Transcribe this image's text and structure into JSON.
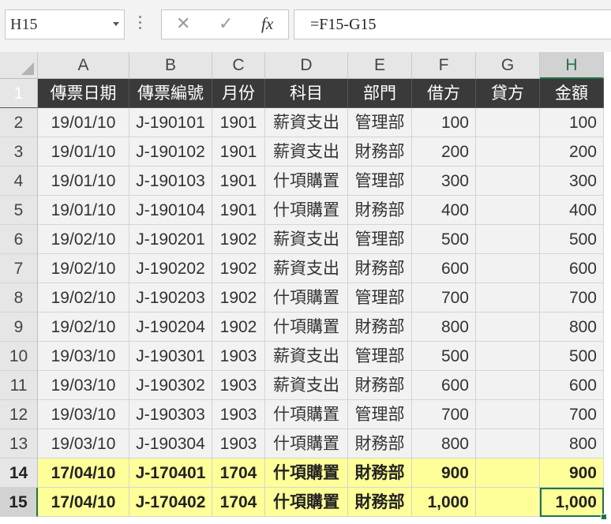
{
  "name_box": "H15",
  "formula": "=F15-G15",
  "fx_label": "fx",
  "columns": [
    "A",
    "B",
    "C",
    "D",
    "E",
    "F",
    "G",
    "H"
  ],
  "header_row": {
    "num": "1",
    "cells": [
      "傳票日期",
      "傳票編號",
      "月份",
      "科目",
      "部門",
      "借方",
      "貸方",
      "金額"
    ]
  },
  "rows": [
    {
      "num": "2",
      "cells": [
        "19/01/10",
        "J-190101",
        "1901",
        "薪資支出",
        "管理部",
        "100",
        "",
        "100"
      ]
    },
    {
      "num": "3",
      "cells": [
        "19/01/10",
        "J-190102",
        "1901",
        "薪資支出",
        "財務部",
        "200",
        "",
        "200"
      ]
    },
    {
      "num": "4",
      "cells": [
        "19/01/10",
        "J-190103",
        "1901",
        "什項購置",
        "管理部",
        "300",
        "",
        "300"
      ]
    },
    {
      "num": "5",
      "cells": [
        "19/01/10",
        "J-190104",
        "1901",
        "什項購置",
        "財務部",
        "400",
        "",
        "400"
      ]
    },
    {
      "num": "6",
      "cells": [
        "19/02/10",
        "J-190201",
        "1902",
        "薪資支出",
        "管理部",
        "500",
        "",
        "500"
      ]
    },
    {
      "num": "7",
      "cells": [
        "19/02/10",
        "J-190202",
        "1902",
        "薪資支出",
        "財務部",
        "600",
        "",
        "600"
      ]
    },
    {
      "num": "8",
      "cells": [
        "19/02/10",
        "J-190203",
        "1902",
        "什項購置",
        "管理部",
        "700",
        "",
        "700"
      ]
    },
    {
      "num": "9",
      "cells": [
        "19/02/10",
        "J-190204",
        "1902",
        "什項購置",
        "財務部",
        "800",
        "",
        "800"
      ]
    },
    {
      "num": "10",
      "cells": [
        "19/03/10",
        "J-190301",
        "1903",
        "薪資支出",
        "管理部",
        "500",
        "",
        "500"
      ]
    },
    {
      "num": "11",
      "cells": [
        "19/03/10",
        "J-190302",
        "1903",
        "薪資支出",
        "財務部",
        "600",
        "",
        "600"
      ]
    },
    {
      "num": "12",
      "cells": [
        "19/03/10",
        "J-190303",
        "1903",
        "什項購置",
        "管理部",
        "700",
        "",
        "700"
      ]
    },
    {
      "num": "13",
      "cells": [
        "19/03/10",
        "J-190304",
        "1903",
        "什項購置",
        "財務部",
        "800",
        "",
        "800"
      ]
    },
    {
      "num": "14",
      "cells": [
        "17/04/10",
        "J-170401",
        "1704",
        "什項購置",
        "財務部",
        "900",
        "",
        "900"
      ],
      "highlight": true
    },
    {
      "num": "15",
      "cells": [
        "17/04/10",
        "J-170402",
        "1704",
        "什項購置",
        "財務部",
        "1,000",
        "",
        "1,000"
      ],
      "highlight": true
    }
  ],
  "selected_cell": "H15",
  "colors": {
    "header_bg": "#3a3a3a",
    "highlight": "#ffff99",
    "accent": "#217346"
  }
}
